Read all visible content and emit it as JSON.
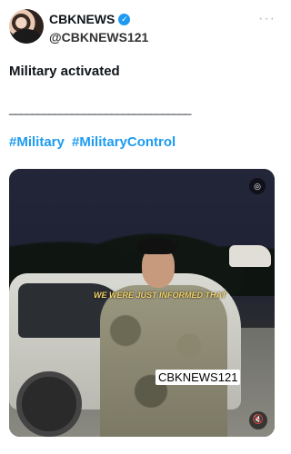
{
  "header": {
    "display_name": "CBKNEWS",
    "handle": "@CBKNEWS121",
    "verified_icon": "verified-check-icon",
    "more_icon": "more-horizontal-icon"
  },
  "post": {
    "title": "Military activated",
    "divider": "________________________________",
    "hashtags": [
      "#Military",
      "#MilitaryControl"
    ]
  },
  "media": {
    "subtitle": "WE WERE JUST INFORMED THAT",
    "watermark": "CBKNEWS121",
    "gif_icon": "gif-badge-icon",
    "mute_icon": "volume-mute-icon"
  }
}
